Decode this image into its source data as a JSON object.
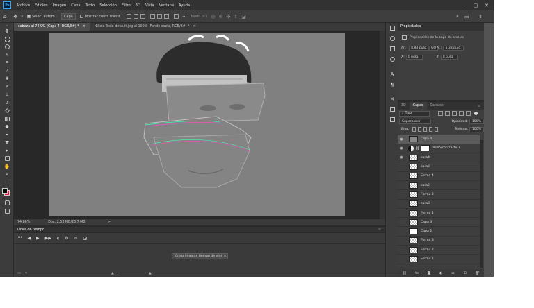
{
  "menubar": {
    "items": [
      "Archivo",
      "Edición",
      "Imagen",
      "Capa",
      "Texto",
      "Selección",
      "Filtro",
      "3D",
      "Vista",
      "Ventana",
      "Ayuda"
    ],
    "controls": [
      "–",
      "▢",
      "✕"
    ]
  },
  "options": {
    "auto_select_label": "Selec. autom.:",
    "auto_select_value": "Capa",
    "transform_label": "Mostrar contr. transf.",
    "mode3d_label": "Modo 3D:"
  },
  "tabs": [
    {
      "label": "cabeza al 74,9% (Capa 4, RGB/8#) *",
      "active": true
    },
    {
      "label": "Nikola-Tesla-default.jpg al 100% (Fondo copia, RGB/8#) *",
      "active": false
    }
  ],
  "status": {
    "zoom": "74,86%",
    "doc": "Doc: 2,53 MB/23,7 MB",
    "arrow": ">"
  },
  "timeline": {
    "title": "Línea de tiempo",
    "create_button": "Crear línea de tiempo de vídeo",
    "dropdown": "▾"
  },
  "properties": {
    "title": "Propiedades",
    "layer_type": "Propiedades de la capa de píxeles",
    "an_label": "An.:",
    "an_value": "8,83 pulg.",
    "al_label": "Al.:",
    "al_value": "5,33 pulg.",
    "link": "GO",
    "x_label": "X:",
    "x_value": "0 pulg.",
    "y_label": "Y:",
    "y_value": "0 pulg."
  },
  "layers_panel": {
    "tabs": [
      "3D",
      "Capas",
      "Canales"
    ],
    "filter_label": "Tipo",
    "blend_mode": "Superponer",
    "opacity_label": "Opacidad:",
    "opacity_value": "100%",
    "lock_label": "Bloq.:",
    "fill_label": "Relleno:",
    "fill_value": "100%",
    "layers": [
      {
        "name": "Capa 4",
        "visible": true,
        "selected": true,
        "thumb": "face"
      },
      {
        "name": "Brillo/contraste 1",
        "visible": true,
        "selected": false,
        "thumb": "white",
        "adjustment": true
      },
      {
        "name": "cara4",
        "visible": true,
        "selected": false,
        "thumb": "check"
      },
      {
        "name": "cara3",
        "visible": false,
        "selected": false,
        "thumb": "check"
      },
      {
        "name": "Forma 4",
        "visible": false,
        "selected": false,
        "thumb": "check"
      },
      {
        "name": "cara2",
        "visible": false,
        "selected": false,
        "thumb": "check"
      },
      {
        "name": "Forma 2",
        "visible": false,
        "selected": false,
        "thumb": "check"
      },
      {
        "name": "cara3",
        "visible": false,
        "selected": false,
        "thumb": "check"
      },
      {
        "name": "Forma 1",
        "visible": false,
        "selected": false,
        "thumb": "check"
      },
      {
        "name": "Capa 3",
        "visible": false,
        "selected": false,
        "thumb": "check"
      },
      {
        "name": "Capa 2",
        "visible": false,
        "selected": false,
        "thumb": "white"
      },
      {
        "name": "Forma 3",
        "visible": false,
        "selected": false,
        "thumb": "check"
      },
      {
        "name": "Forma 2",
        "visible": false,
        "selected": false,
        "thumb": "check"
      },
      {
        "name": "Forma 1",
        "visible": false,
        "selected": false,
        "thumb": "check"
      }
    ]
  },
  "colors": {
    "accent": "#31a8ff",
    "foreground_swatch": "#000000",
    "background_swatch": "#e0173c"
  }
}
